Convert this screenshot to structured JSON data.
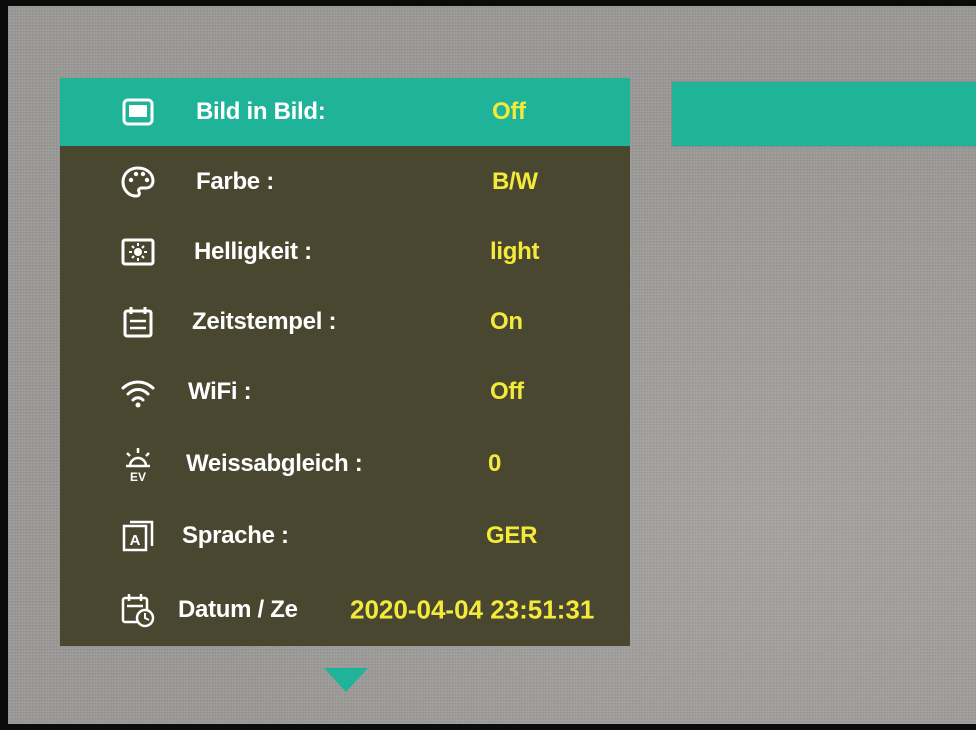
{
  "menu": {
    "items": [
      {
        "icon": "picture-in-picture-icon",
        "label": "Bild in Bild:",
        "value": "Off",
        "selected": true
      },
      {
        "icon": "palette-icon",
        "label": "Farbe :",
        "value": "B/W"
      },
      {
        "icon": "brightness-icon",
        "label": "Helligkeit :",
        "value": "light"
      },
      {
        "icon": "calendar-stamp-icon",
        "label": "Zeitstempel :",
        "value": "On"
      },
      {
        "icon": "wifi-icon",
        "label": "WiFi :",
        "value": "Off"
      },
      {
        "icon": "ev-exposure-icon",
        "label": "Weissabgleich  :",
        "value": "0"
      },
      {
        "icon": "language-icon",
        "label": "Sprache :",
        "value": "GER"
      },
      {
        "icon": "date-time-icon",
        "label": "Datum / Ze",
        "value": "2020-04-04 23:51:31"
      }
    ]
  },
  "colors": {
    "accent": "#1fb39a",
    "panel": "#4a4731",
    "value_text": "#f4ea3a",
    "label_text": "#ffffff"
  }
}
